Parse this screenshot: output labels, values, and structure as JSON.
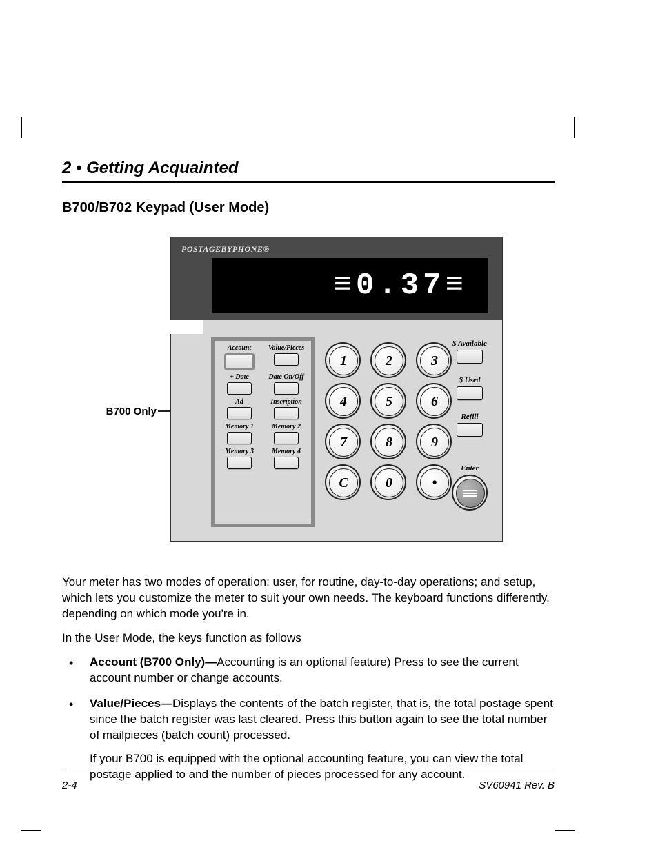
{
  "chapter": "2 • Getting Acquainted",
  "section": "B700/B702 Keypad (User Mode)",
  "device": {
    "brand": "POSTAGEBYPHONE®",
    "display": "≡0.37≡"
  },
  "func_keys": [
    [
      {
        "label": "Account",
        "highlighted": true
      },
      {
        "label": "Value/Pieces"
      }
    ],
    [
      {
        "label": "+ Date"
      },
      {
        "label": "Date On/Off"
      }
    ],
    [
      {
        "label": "Ad"
      },
      {
        "label": "Inscription"
      }
    ],
    [
      {
        "label": "Memory 1"
      },
      {
        "label": "Memory 2"
      }
    ],
    [
      {
        "label": "Memory 3"
      },
      {
        "label": "Memory 4"
      }
    ]
  ],
  "num_keys": [
    [
      "1",
      "2",
      "3"
    ],
    [
      "4",
      "5",
      "6"
    ],
    [
      "7",
      "8",
      "9"
    ],
    [
      "C",
      "0",
      "•"
    ]
  ],
  "right_keys": [
    {
      "label": "$ Available"
    },
    {
      "label": "$ Used"
    },
    {
      "label": "Refill"
    }
  ],
  "enter_label": "Enter",
  "callout": "B700 Only",
  "para1": "Your meter has two modes of operation: user, for routine, day-to-day operations; and setup, which lets you customize the meter to suit your own needs. The keyboard functions differently, depending on which mode you're in.",
  "para2": "In the User Mode, the keys function as follows",
  "bul1_term": "Account (B700 Only)—",
  "bul1_text": "Accounting is an optional feature) Press to see the current account number or change accounts.",
  "bul2_term": "Value/Pieces—",
  "bul2_text": "Displays the contents of the batch register, that is, the total postage spent since the batch register was last cleared. Press this button again to see the total number of mailpieces (batch count) processed.",
  "bul2_sub": "If your B700 is equipped with the optional accounting feature, you can view the total postage applied to and the number of pieces processed for any account.",
  "footer": {
    "page": "2-4",
    "rev": "SV60941 Rev. B"
  }
}
